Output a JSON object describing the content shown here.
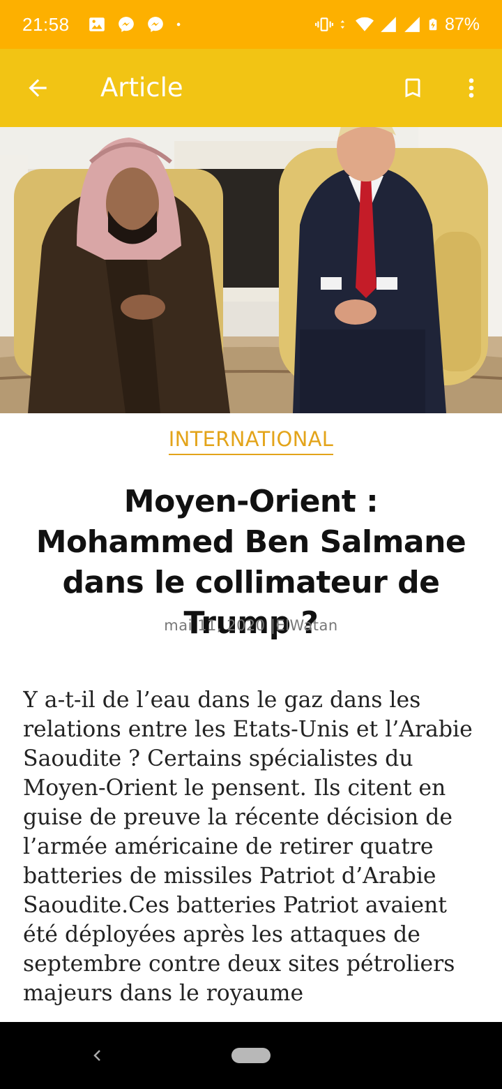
{
  "status_bar": {
    "time": "21:58",
    "battery": "87%",
    "left_icons": [
      "image-icon",
      "messenger-icon",
      "messenger-icon",
      "dot-icon"
    ],
    "right_icons": [
      "vibrate-icon",
      "data-arrows-icon",
      "wifi-icon",
      "signal-icon",
      "signal-icon",
      "battery-charging-icon"
    ]
  },
  "app_bar": {
    "title": "Article",
    "back_icon": "arrow-back-icon",
    "bookmark_icon": "bookmark-icon",
    "more_icon": "more-vert-icon",
    "color": "#F2C414"
  },
  "article": {
    "category": "INTERNATIONAL",
    "headline": "Moyen-Orient : Mohammed Ben Salmane dans le collimateur de Trump ?",
    "meta": "mai 11, 2020 |ElWatan",
    "body": "Y a-t-il de l’eau dans le gaz dans les relations entre les Etats-Unis et l’Arabie Saoudite ? Certains spécialistes du Moyen-Orient le pensent. Ils citent en guise de preuve la récente décision de l’armée américaine de retirer quatre batteries de missiles Patriot d’Arabie Saoudite.Ces batteries Patriot avaient été déployées après les attaques de septembre contre deux sites pétroliers majeurs dans le royaume"
  },
  "colors": {
    "status_bar": "#FDB000",
    "accent": "#E3A41A"
  }
}
